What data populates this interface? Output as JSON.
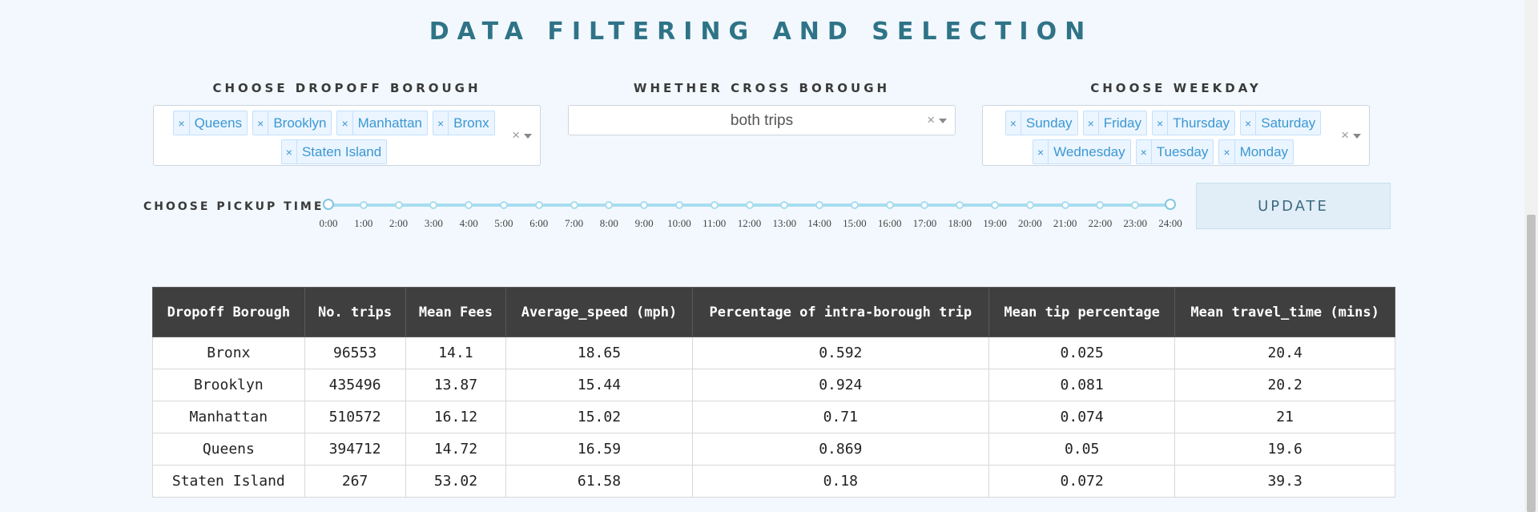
{
  "title": "DATA FILTERING AND SELECTION",
  "dropoff": {
    "label": "CHOOSE DROPOFF BOROUGH",
    "selected": [
      "Queens",
      "Brooklyn",
      "Manhattan",
      "Bronx",
      "Staten Island"
    ],
    "remove_glyph": "×",
    "clear_glyph": "×"
  },
  "cross": {
    "label": "WHETHER CROSS BOROUGH",
    "value": "both trips",
    "clear_glyph": "×"
  },
  "weekday": {
    "label": "CHOOSE WEEKDAY",
    "selected": [
      "Sunday",
      "Friday",
      "Thursday",
      "Saturday",
      "Wednesday",
      "Tuesday",
      "Monday"
    ],
    "remove_glyph": "×",
    "clear_glyph": "×"
  },
  "pickup": {
    "label": "CHOOSE PICKUP TIME",
    "ticks": [
      "0:00",
      "1:00",
      "2:00",
      "3:00",
      "4:00",
      "5:00",
      "6:00",
      "7:00",
      "8:00",
      "9:00",
      "10:00",
      "11:00",
      "12:00",
      "13:00",
      "14:00",
      "15:00",
      "16:00",
      "17:00",
      "18:00",
      "19:00",
      "20:00",
      "21:00",
      "22:00",
      "23:00",
      "24:00"
    ],
    "range": [
      0,
      24
    ]
  },
  "update_label": "UPDATE",
  "table": {
    "columns": [
      "Dropoff Borough",
      "No. trips",
      "Mean Fees",
      "Average_speed (mph)",
      "Percentage of intra-borough trip",
      "Mean tip percentage",
      "Mean travel_time (mins)"
    ],
    "rows": [
      [
        "Bronx",
        "96553",
        "14.1",
        "18.65",
        "0.592",
        "0.025",
        "20.4"
      ],
      [
        "Brooklyn",
        "435496",
        "13.87",
        "15.44",
        "0.924",
        "0.081",
        "20.2"
      ],
      [
        "Manhattan",
        "510572",
        "16.12",
        "15.02",
        "0.71",
        "0.074",
        "21"
      ],
      [
        "Queens",
        "394712",
        "14.72",
        "16.59",
        "0.869",
        "0.05",
        "19.6"
      ],
      [
        "Staten Island",
        "267",
        "53.02",
        "61.58",
        "0.18",
        "0.072",
        "39.3"
      ]
    ]
  }
}
